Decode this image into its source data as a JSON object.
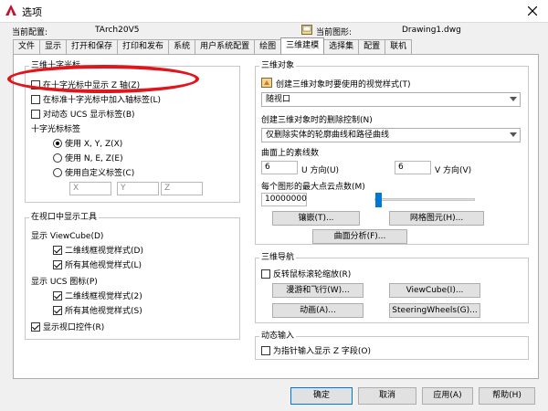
{
  "window": {
    "title": "选项"
  },
  "header": {
    "config_label": "当前配置:",
    "config_value": "TArch20V5",
    "drawing_label": "当前图形:",
    "drawing_value": "Drawing1.dwg"
  },
  "tabs": [
    "文件",
    "显示",
    "打开和保存",
    "打印和发布",
    "系统",
    "用户系统配置",
    "绘图",
    "三维建模",
    "选择集",
    "配置",
    "联机"
  ],
  "crosshair": {
    "title": "三维十字光标",
    "show_z": "在十字光标中显示 Z 轴(Z)",
    "show_axis": "在标准十字光标中加入轴标签(L)",
    "ucs_labels": "对动态 UCS 显示标签(B)",
    "label_title": "十字光标标签",
    "opt_xyz": "使用 X, Y, Z(X)",
    "opt_nez": "使用 N, E, Z(E)",
    "opt_custom": "使用自定义标签(C)",
    "custom_x": "X",
    "custom_y": "Y",
    "custom_z": "Z"
  },
  "viewport_tools": {
    "title": "在视口中显示工具",
    "viewcube_label": "显示 ViewCube(D)",
    "vc_2d": "二维线框视觉样式(D)",
    "vc_other": "所有其他视觉样式(L)",
    "ucs_label": "显示 UCS 图标(P)",
    "ucs_2d": "二维线框视觉样式(2)",
    "ucs_other": "所有其他视觉样式(S)",
    "viewport_ctrl": "显示视口控件(R)"
  },
  "objects3d": {
    "title": "三维对象",
    "visual_style_label": "创建三维对象时要使用的视觉样式(T)",
    "visual_style_value": "随视口",
    "delete_ctrl_label": "创建三维对象时的删除控制(N)",
    "delete_ctrl_value": "仅删除实体的轮廓曲线和路径曲线",
    "isolines_label": "曲面上的素线数",
    "u_value": "6",
    "u_label": "U 方向(U)",
    "v_value": "6",
    "v_label": "V 方向(V)",
    "max_points_label": "每个图形的最大点云点数(M)",
    "max_points_value": "10000000",
    "tessellation_btn": "镶嵌(T)...",
    "mesh_btn": "网格图元(H)...",
    "analysis_btn": "曲面分析(F)..."
  },
  "navigation": {
    "title": "三维导航",
    "reverse_wheel": "反转鼠标滚轮缩放(R)",
    "walkfly_btn": "漫游和飞行(W)...",
    "viewcube_btn": "ViewCube(I)...",
    "animation_btn": "动画(A)...",
    "steering_btn": "SteeringWheels(G)..."
  },
  "dynamic_input": {
    "title": "动态输入",
    "show_z_field": "为指针输入显示 Z 字段(O)"
  },
  "footer": {
    "ok": "确定",
    "cancel": "取消",
    "apply": "应用(A)",
    "help": "帮助(H)"
  },
  "colors": {
    "accent": "#0078d7",
    "annotation": "#e0161d"
  }
}
